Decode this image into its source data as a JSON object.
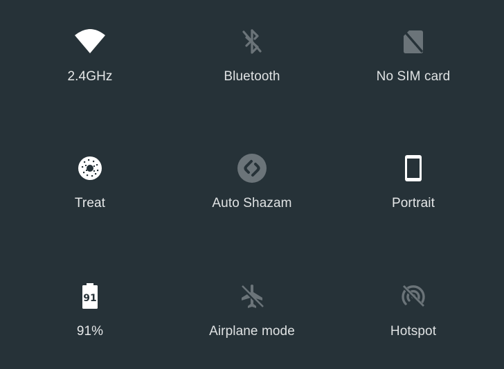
{
  "quick_settings": {
    "tiles": [
      {
        "label": "2.4GHz",
        "icon": "wifi-icon",
        "state": "on"
      },
      {
        "label": "Bluetooth",
        "icon": "bluetooth-disabled-icon",
        "state": "off"
      },
      {
        "label": "No SIM card",
        "icon": "no-sim-icon",
        "state": "off"
      },
      {
        "label": "Treat",
        "icon": "donut-icon",
        "state": "on"
      },
      {
        "label": "Auto Shazam",
        "icon": "shazam-icon",
        "state": "off"
      },
      {
        "label": "Portrait",
        "icon": "portrait-phone-icon",
        "state": "on"
      },
      {
        "label": "91%",
        "icon": "battery-icon",
        "state": "on",
        "battery_level": "91"
      },
      {
        "label": "Airplane mode",
        "icon": "airplane-off-icon",
        "state": "off"
      },
      {
        "label": "Hotspot",
        "icon": "hotspot-off-icon",
        "state": "off"
      }
    ]
  },
  "colors": {
    "background": "#263238",
    "icon_on": "#ffffff",
    "icon_off": "#6b7479",
    "label": "#e6e8e9"
  }
}
